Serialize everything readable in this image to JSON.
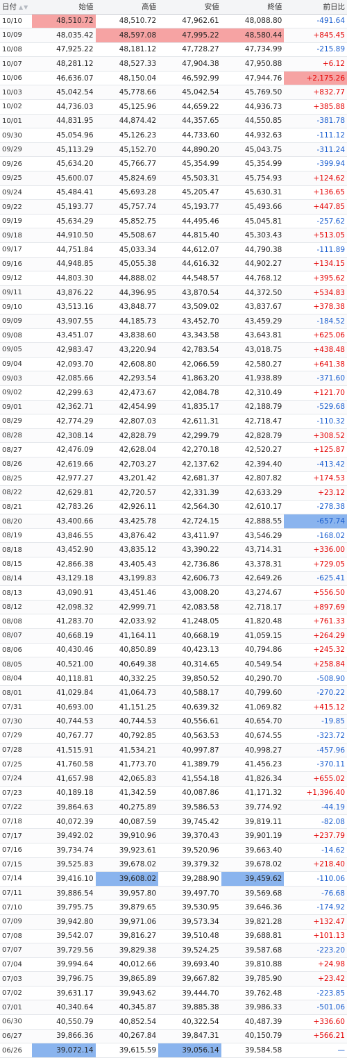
{
  "headers": [
    "日付",
    "始値",
    "高値",
    "安値",
    "終値",
    "前日比"
  ],
  "sort_icon": "sort-arrows-icon",
  "colors": {
    "positive": "#e40000",
    "negative": "#1a5ecf",
    "max_highlight": "#f6a3a3",
    "min_highlight": "#8ab4ee"
  },
  "rows": [
    {
      "date": "10/10",
      "open": "48,510.72",
      "high": "48,510.72",
      "low": "47,962.61",
      "close": "48,088.80",
      "change": "-491.64",
      "hl": {
        "open": "max"
      }
    },
    {
      "date": "10/09",
      "open": "48,035.42",
      "high": "48,597.08",
      "low": "47,995.22",
      "close": "48,580.44",
      "change": "+845.45",
      "hl": {
        "high": "max",
        "low": "max",
        "close": "max"
      }
    },
    {
      "date": "10/08",
      "open": "47,925.22",
      "high": "48,181.12",
      "low": "47,728.27",
      "close": "47,734.99",
      "change": "-215.89"
    },
    {
      "date": "10/07",
      "open": "48,281.12",
      "high": "48,527.33",
      "low": "47,904.38",
      "close": "47,950.88",
      "change": "+6.12"
    },
    {
      "date": "10/06",
      "open": "46,636.07",
      "high": "48,150.04",
      "low": "46,592.99",
      "close": "47,944.76",
      "change": "+2,175.26",
      "hl": {
        "change": "max"
      }
    },
    {
      "date": "10/03",
      "open": "45,042.54",
      "high": "45,778.66",
      "low": "45,042.54",
      "close": "45,769.50",
      "change": "+832.77"
    },
    {
      "date": "10/02",
      "open": "44,736.03",
      "high": "45,125.96",
      "low": "44,659.22",
      "close": "44,936.73",
      "change": "+385.88"
    },
    {
      "date": "10/01",
      "open": "44,831.95",
      "high": "44,874.42",
      "low": "44,357.65",
      "close": "44,550.85",
      "change": "-381.78"
    },
    {
      "date": "09/30",
      "open": "45,054.96",
      "high": "45,126.23",
      "low": "44,733.60",
      "close": "44,932.63",
      "change": "-111.12"
    },
    {
      "date": "09/29",
      "open": "45,113.29",
      "high": "45,152.70",
      "low": "44,890.20",
      "close": "45,043.75",
      "change": "-311.24"
    },
    {
      "date": "09/26",
      "open": "45,634.20",
      "high": "45,766.77",
      "low": "45,354.99",
      "close": "45,354.99",
      "change": "-399.94"
    },
    {
      "date": "09/25",
      "open": "45,600.07",
      "high": "45,824.69",
      "low": "45,503.31",
      "close": "45,754.93",
      "change": "+124.62"
    },
    {
      "date": "09/24",
      "open": "45,484.41",
      "high": "45,693.28",
      "low": "45,205.47",
      "close": "45,630.31",
      "change": "+136.65"
    },
    {
      "date": "09/22",
      "open": "45,193.77",
      "high": "45,757.74",
      "low": "45,193.77",
      "close": "45,493.66",
      "change": "+447.85"
    },
    {
      "date": "09/19",
      "open": "45,634.29",
      "high": "45,852.75",
      "low": "44,495.46",
      "close": "45,045.81",
      "change": "-257.62"
    },
    {
      "date": "09/18",
      "open": "44,910.50",
      "high": "45,508.67",
      "low": "44,815.40",
      "close": "45,303.43",
      "change": "+513.05"
    },
    {
      "date": "09/17",
      "open": "44,751.84",
      "high": "45,033.34",
      "low": "44,612.07",
      "close": "44,790.38",
      "change": "-111.89"
    },
    {
      "date": "09/16",
      "open": "44,948.85",
      "high": "45,055.38",
      "low": "44,616.32",
      "close": "44,902.27",
      "change": "+134.15"
    },
    {
      "date": "09/12",
      "open": "44,803.30",
      "high": "44,888.02",
      "low": "44,548.57",
      "close": "44,768.12",
      "change": "+395.62"
    },
    {
      "date": "09/11",
      "open": "43,876.22",
      "high": "44,396.95",
      "low": "43,870.54",
      "close": "44,372.50",
      "change": "+534.83"
    },
    {
      "date": "09/10",
      "open": "43,513.16",
      "high": "43,848.77",
      "low": "43,509.02",
      "close": "43,837.67",
      "change": "+378.38"
    },
    {
      "date": "09/09",
      "open": "43,907.55",
      "high": "44,185.73",
      "low": "43,452.70",
      "close": "43,459.29",
      "change": "-184.52"
    },
    {
      "date": "09/08",
      "open": "43,451.07",
      "high": "43,838.60",
      "low": "43,343.58",
      "close": "43,643.81",
      "change": "+625.06"
    },
    {
      "date": "09/05",
      "open": "42,983.47",
      "high": "43,220.94",
      "low": "42,783.54",
      "close": "43,018.75",
      "change": "+438.48"
    },
    {
      "date": "09/04",
      "open": "42,093.70",
      "high": "42,608.80",
      "low": "42,066.59",
      "close": "42,580.27",
      "change": "+641.38"
    },
    {
      "date": "09/03",
      "open": "42,085.66",
      "high": "42,293.54",
      "low": "41,863.20",
      "close": "41,938.89",
      "change": "-371.60"
    },
    {
      "date": "09/02",
      "open": "42,299.63",
      "high": "42,473.67",
      "low": "42,084.78",
      "close": "42,310.49",
      "change": "+121.70"
    },
    {
      "date": "09/01",
      "open": "42,362.71",
      "high": "42,454.99",
      "low": "41,835.17",
      "close": "42,188.79",
      "change": "-529.68"
    },
    {
      "date": "08/29",
      "open": "42,774.29",
      "high": "42,807.03",
      "low": "42,611.31",
      "close": "42,718.47",
      "change": "-110.32"
    },
    {
      "date": "08/28",
      "open": "42,308.14",
      "high": "42,828.79",
      "low": "42,299.79",
      "close": "42,828.79",
      "change": "+308.52"
    },
    {
      "date": "08/27",
      "open": "42,476.09",
      "high": "42,628.04",
      "low": "42,270.18",
      "close": "42,520.27",
      "change": "+125.87"
    },
    {
      "date": "08/26",
      "open": "42,619.66",
      "high": "42,703.27",
      "low": "42,137.62",
      "close": "42,394.40",
      "change": "-413.42"
    },
    {
      "date": "08/25",
      "open": "42,977.27",
      "high": "43,201.42",
      "low": "42,681.37",
      "close": "42,807.82",
      "change": "+174.53"
    },
    {
      "date": "08/22",
      "open": "42,629.81",
      "high": "42,720.57",
      "low": "42,331.39",
      "close": "42,633.29",
      "change": "+23.12"
    },
    {
      "date": "08/21",
      "open": "42,783.26",
      "high": "42,926.11",
      "low": "42,564.30",
      "close": "42,610.17",
      "change": "-278.38"
    },
    {
      "date": "08/20",
      "open": "43,400.66",
      "high": "43,425.78",
      "low": "42,724.15",
      "close": "42,888.55",
      "change": "-657.74",
      "hl": {
        "change": "min"
      }
    },
    {
      "date": "08/19",
      "open": "43,846.55",
      "high": "43,876.42",
      "low": "43,411.97",
      "close": "43,546.29",
      "change": "-168.02"
    },
    {
      "date": "08/18",
      "open": "43,452.90",
      "high": "43,835.12",
      "low": "43,390.22",
      "close": "43,714.31",
      "change": "+336.00"
    },
    {
      "date": "08/15",
      "open": "42,866.38",
      "high": "43,405.43",
      "low": "42,736.86",
      "close": "43,378.31",
      "change": "+729.05"
    },
    {
      "date": "08/14",
      "open": "43,129.18",
      "high": "43,199.83",
      "low": "42,606.73",
      "close": "42,649.26",
      "change": "-625.41"
    },
    {
      "date": "08/13",
      "open": "43,090.91",
      "high": "43,451.46",
      "low": "43,008.20",
      "close": "43,274.67",
      "change": "+556.50"
    },
    {
      "date": "08/12",
      "open": "42,098.32",
      "high": "42,999.71",
      "low": "42,083.58",
      "close": "42,718.17",
      "change": "+897.69"
    },
    {
      "date": "08/08",
      "open": "41,283.70",
      "high": "42,033.92",
      "low": "41,248.05",
      "close": "41,820.48",
      "change": "+761.33"
    },
    {
      "date": "08/07",
      "open": "40,668.19",
      "high": "41,164.11",
      "low": "40,668.19",
      "close": "41,059.15",
      "change": "+264.29"
    },
    {
      "date": "08/06",
      "open": "40,430.46",
      "high": "40,850.89",
      "low": "40,423.13",
      "close": "40,794.86",
      "change": "+245.32"
    },
    {
      "date": "08/05",
      "open": "40,521.00",
      "high": "40,649.38",
      "low": "40,314.65",
      "close": "40,549.54",
      "change": "+258.84"
    },
    {
      "date": "08/04",
      "open": "40,118.81",
      "high": "40,332.25",
      "low": "39,850.52",
      "close": "40,290.70",
      "change": "-508.90"
    },
    {
      "date": "08/01",
      "open": "41,029.84",
      "high": "41,064.73",
      "low": "40,588.17",
      "close": "40,799.60",
      "change": "-270.22"
    },
    {
      "date": "07/31",
      "open": "40,693.00",
      "high": "41,151.25",
      "low": "40,639.32",
      "close": "41,069.82",
      "change": "+415.12"
    },
    {
      "date": "07/30",
      "open": "40,744.53",
      "high": "40,744.53",
      "low": "40,556.61",
      "close": "40,654.70",
      "change": "-19.85"
    },
    {
      "date": "07/29",
      "open": "40,767.77",
      "high": "40,792.85",
      "low": "40,563.53",
      "close": "40,674.55",
      "change": "-323.72"
    },
    {
      "date": "07/28",
      "open": "41,515.91",
      "high": "41,534.21",
      "low": "40,997.87",
      "close": "40,998.27",
      "change": "-457.96"
    },
    {
      "date": "07/25",
      "open": "41,760.58",
      "high": "41,773.70",
      "low": "41,389.79",
      "close": "41,456.23",
      "change": "-370.11"
    },
    {
      "date": "07/24",
      "open": "41,657.98",
      "high": "42,065.83",
      "low": "41,554.18",
      "close": "41,826.34",
      "change": "+655.02"
    },
    {
      "date": "07/23",
      "open": "40,189.18",
      "high": "41,342.59",
      "low": "40,087.86",
      "close": "41,171.32",
      "change": "+1,396.40"
    },
    {
      "date": "07/22",
      "open": "39,864.63",
      "high": "40,275.89",
      "low": "39,586.53",
      "close": "39,774.92",
      "change": "-44.19"
    },
    {
      "date": "07/18",
      "open": "40,072.39",
      "high": "40,087.59",
      "low": "39,745.42",
      "close": "39,819.11",
      "change": "-82.08"
    },
    {
      "date": "07/17",
      "open": "39,492.02",
      "high": "39,910.96",
      "low": "39,370.43",
      "close": "39,901.19",
      "change": "+237.79"
    },
    {
      "date": "07/16",
      "open": "39,734.74",
      "high": "39,923.61",
      "low": "39,520.96",
      "close": "39,663.40",
      "change": "-14.62"
    },
    {
      "date": "07/15",
      "open": "39,525.83",
      "high": "39,678.02",
      "low": "39,379.32",
      "close": "39,678.02",
      "change": "+218.40"
    },
    {
      "date": "07/14",
      "open": "39,416.10",
      "high": "39,608.02",
      "low": "39,288.90",
      "close": "39,459.62",
      "change": "-110.06",
      "hl": {
        "high": "min",
        "close": "min"
      }
    },
    {
      "date": "07/11",
      "open": "39,886.54",
      "high": "39,957.80",
      "low": "39,497.70",
      "close": "39,569.68",
      "change": "-76.68"
    },
    {
      "date": "07/10",
      "open": "39,795.75",
      "high": "39,879.65",
      "low": "39,530.95",
      "close": "39,646.36",
      "change": "-174.92"
    },
    {
      "date": "07/09",
      "open": "39,942.80",
      "high": "39,971.06",
      "low": "39,573.34",
      "close": "39,821.28",
      "change": "+132.47"
    },
    {
      "date": "07/08",
      "open": "39,542.07",
      "high": "39,816.27",
      "low": "39,510.48",
      "close": "39,688.81",
      "change": "+101.13"
    },
    {
      "date": "07/07",
      "open": "39,729.56",
      "high": "39,829.38",
      "low": "39,524.25",
      "close": "39,587.68",
      "change": "-223.20"
    },
    {
      "date": "07/04",
      "open": "39,994.64",
      "high": "40,012.66",
      "low": "39,693.40",
      "close": "39,810.88",
      "change": "+24.98"
    },
    {
      "date": "07/03",
      "open": "39,796.75",
      "high": "39,865.89",
      "low": "39,667.82",
      "close": "39,785.90",
      "change": "+23.42"
    },
    {
      "date": "07/02",
      "open": "39,631.17",
      "high": "39,943.62",
      "low": "39,444.70",
      "close": "39,762.48",
      "change": "-223.85"
    },
    {
      "date": "07/01",
      "open": "40,340.64",
      "high": "40,345.87",
      "low": "39,885.38",
      "close": "39,986.33",
      "change": "-501.06"
    },
    {
      "date": "06/30",
      "open": "40,550.79",
      "high": "40,852.54",
      "low": "40,322.54",
      "close": "40,487.39",
      "change": "+336.60"
    },
    {
      "date": "06/27",
      "open": "39,866.36",
      "high": "40,267.84",
      "low": "39,847.31",
      "close": "40,150.79",
      "change": "+566.21"
    },
    {
      "date": "06/26",
      "open": "39,072.14",
      "high": "39,615.59",
      "low": "39,056.14",
      "close": "39,584.58",
      "change": "—",
      "hl": {
        "open": "min",
        "low": "min"
      }
    }
  ]
}
